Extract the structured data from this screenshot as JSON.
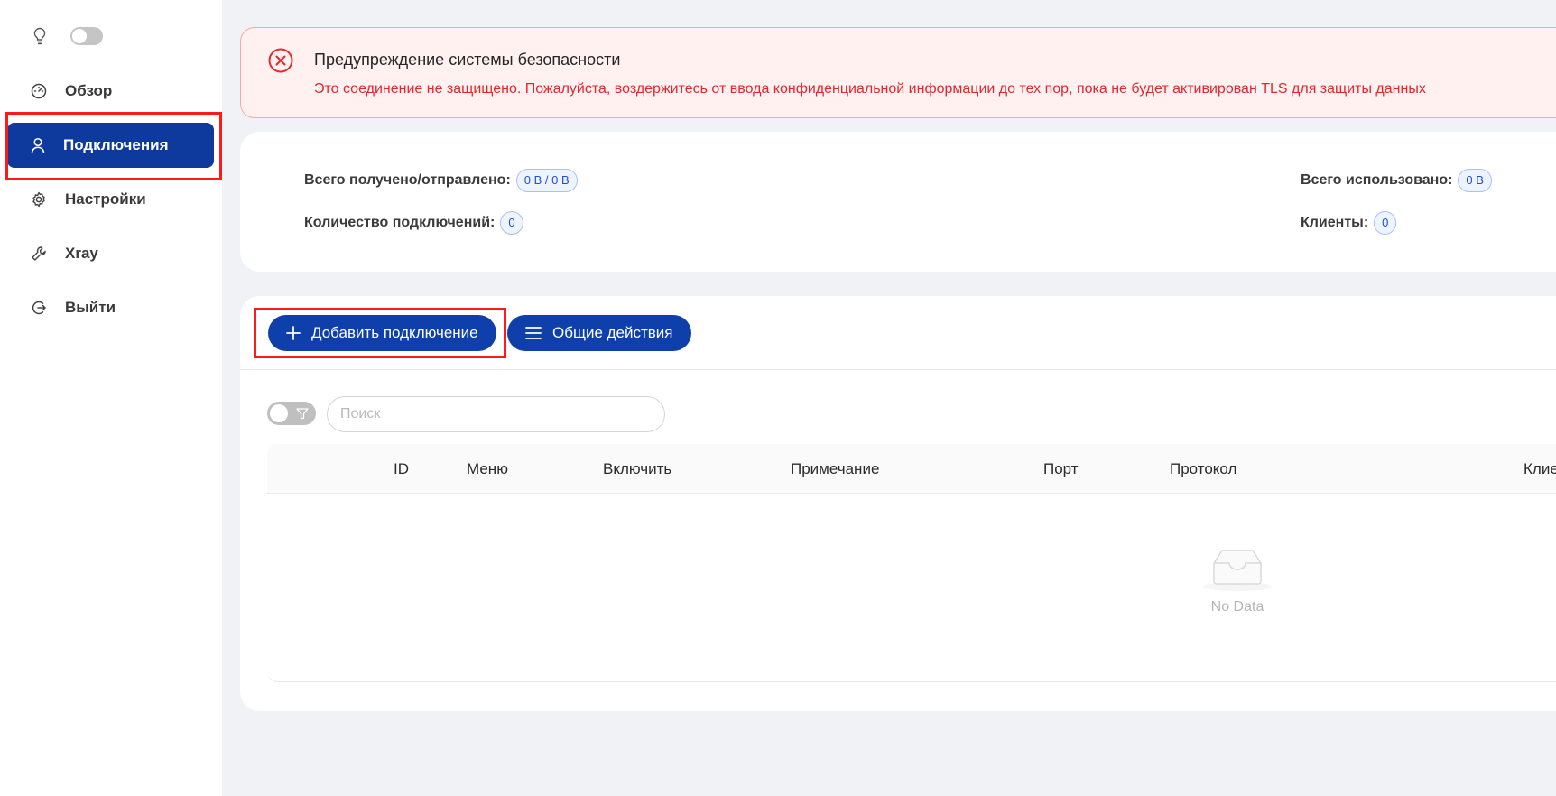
{
  "sidebar": {
    "items": [
      {
        "label": "Обзор",
        "icon": "dashboard-icon"
      },
      {
        "label": "Подключения",
        "icon": "user-icon",
        "active": true
      },
      {
        "label": "Настройки",
        "icon": "gear-icon"
      },
      {
        "label": "Xray",
        "icon": "wrench-icon"
      },
      {
        "label": "Выйти",
        "icon": "logout-icon"
      }
    ]
  },
  "alert": {
    "title": "Предупреждение системы безопасности",
    "description": "Это соединение не защищено. Пожалуйста, воздержитесь от ввода конфиденциальной информации до тех пор, пока не будет активирован TLS для защиты данных"
  },
  "stats": {
    "total_traffic_label": "Всего получено/отправлено:",
    "total_traffic_value": "0 B / 0 B",
    "total_used_label": "Всего использовано:",
    "total_used_value": "0 B",
    "connections_label": "Количество подключений:",
    "connections_value": "0",
    "clients_label": "Клиенты:",
    "clients_value": "0"
  },
  "toolbar": {
    "add_label": "Добавить подключение",
    "actions_label": "Общие действия"
  },
  "search": {
    "placeholder": "Поиск"
  },
  "table": {
    "columns": [
      "ID",
      "Меню",
      "Включить",
      "Примечание",
      "Порт",
      "Протокол",
      "Клие"
    ],
    "empty_text": "No Data"
  },
  "colors": {
    "primary": "#0e3fab",
    "alert_text": "#e0282e",
    "highlight": "#ff1a1a"
  }
}
